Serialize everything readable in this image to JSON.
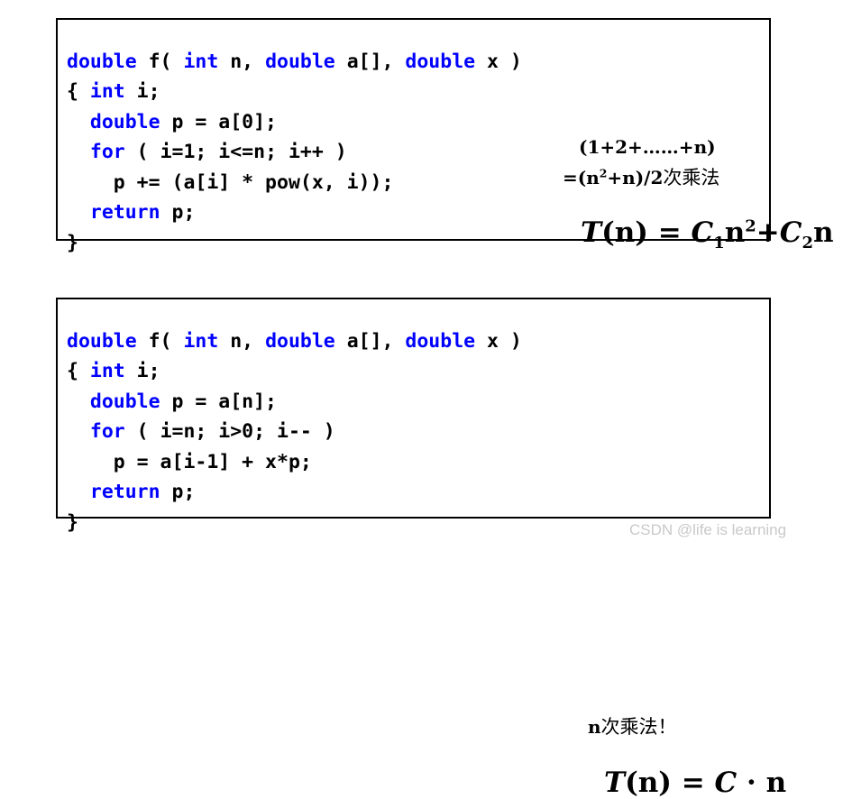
{
  "background_color": "#ffffff",
  "keyword_color": "#0000ff",
  "text_color": "#000000",
  "border_color": "#000000",
  "watermark_color": "#c9c9c9",
  "boxes": [
    {
      "id": "box-1",
      "code_lines": [
        [
          {
            "t": "double",
            "kw": true
          },
          {
            "t": " f( ",
            "kw": false
          },
          {
            "t": "int",
            "kw": true
          },
          {
            "t": " n, ",
            "kw": false
          },
          {
            "t": "double",
            "kw": true
          },
          {
            "t": " a[], ",
            "kw": false
          },
          {
            "t": "double",
            "kw": true
          },
          {
            "t": " x )",
            "kw": false
          }
        ],
        [
          {
            "t": "{ ",
            "kw": false
          },
          {
            "t": "int",
            "kw": true
          },
          {
            "t": " i;",
            "kw": false
          }
        ],
        [
          {
            "t": "  ",
            "kw": false
          },
          {
            "t": "double",
            "kw": true
          },
          {
            "t": " p = a[0];",
            "kw": false
          }
        ],
        [
          {
            "t": "  ",
            "kw": false
          },
          {
            "t": "for",
            "kw": true
          },
          {
            "t": " ( i=1; i<=n; i++ )",
            "kw": false
          }
        ],
        [
          {
            "t": "    p += (a[i] * pow(x, i));",
            "kw": false
          }
        ],
        [
          {
            "t": "  ",
            "kw": false
          },
          {
            "t": "return",
            "kw": true
          },
          {
            "t": " p;",
            "kw": false
          }
        ],
        [
          {
            "t": "}",
            "kw": false
          }
        ]
      ],
      "annotation_line_1": "(1+2+……+n)",
      "annotation_line_2_prefix": "=(n",
      "annotation_line_2_sup": "2",
      "annotation_line_2_mid": "+n)/2",
      "annotation_line_2_cjk": "次乘法",
      "formula": {
        "lhs_var": "T",
        "lhs_arg": "(n) = ",
        "c1": "C",
        "c1_sub": "1",
        "c1_var": "n",
        "c1_sup": "2",
        "plus": "+",
        "c2": "C",
        "c2_sub": "2",
        "c2_var": "n"
      }
    },
    {
      "id": "box-2",
      "code_lines": [
        [
          {
            "t": "double",
            "kw": true
          },
          {
            "t": " f( ",
            "kw": false
          },
          {
            "t": "int",
            "kw": true
          },
          {
            "t": " n, ",
            "kw": false
          },
          {
            "t": "double",
            "kw": true
          },
          {
            "t": " a[], ",
            "kw": false
          },
          {
            "t": "double",
            "kw": true
          },
          {
            "t": " x )",
            "kw": false
          }
        ],
        [
          {
            "t": "{ ",
            "kw": false
          },
          {
            "t": "int",
            "kw": true
          },
          {
            "t": " i;",
            "kw": false
          }
        ],
        [
          {
            "t": "  ",
            "kw": false
          },
          {
            "t": "double",
            "kw": true
          },
          {
            "t": " p = a[n];",
            "kw": false
          }
        ],
        [
          {
            "t": "  ",
            "kw": false
          },
          {
            "t": "for",
            "kw": true
          },
          {
            "t": " ( i=n; i>0; i-- )",
            "kw": false
          }
        ],
        [
          {
            "t": "    p = a[i-1] + x*p;",
            "kw": false
          }
        ],
        [
          {
            "t": "  ",
            "kw": false
          },
          {
            "t": "return",
            "kw": true
          },
          {
            "t": " p;",
            "kw": false
          }
        ],
        [
          {
            "t": "}",
            "kw": false
          }
        ]
      ],
      "annotation_prefix": "n",
      "annotation_cjk": "次乘法！",
      "formula": {
        "lhs_var": "T",
        "lhs_arg": "(n) = ",
        "c": "C",
        "dot": " · ",
        "rhs_var": "n"
      }
    }
  ],
  "watermark": "CSDN @life is learning"
}
